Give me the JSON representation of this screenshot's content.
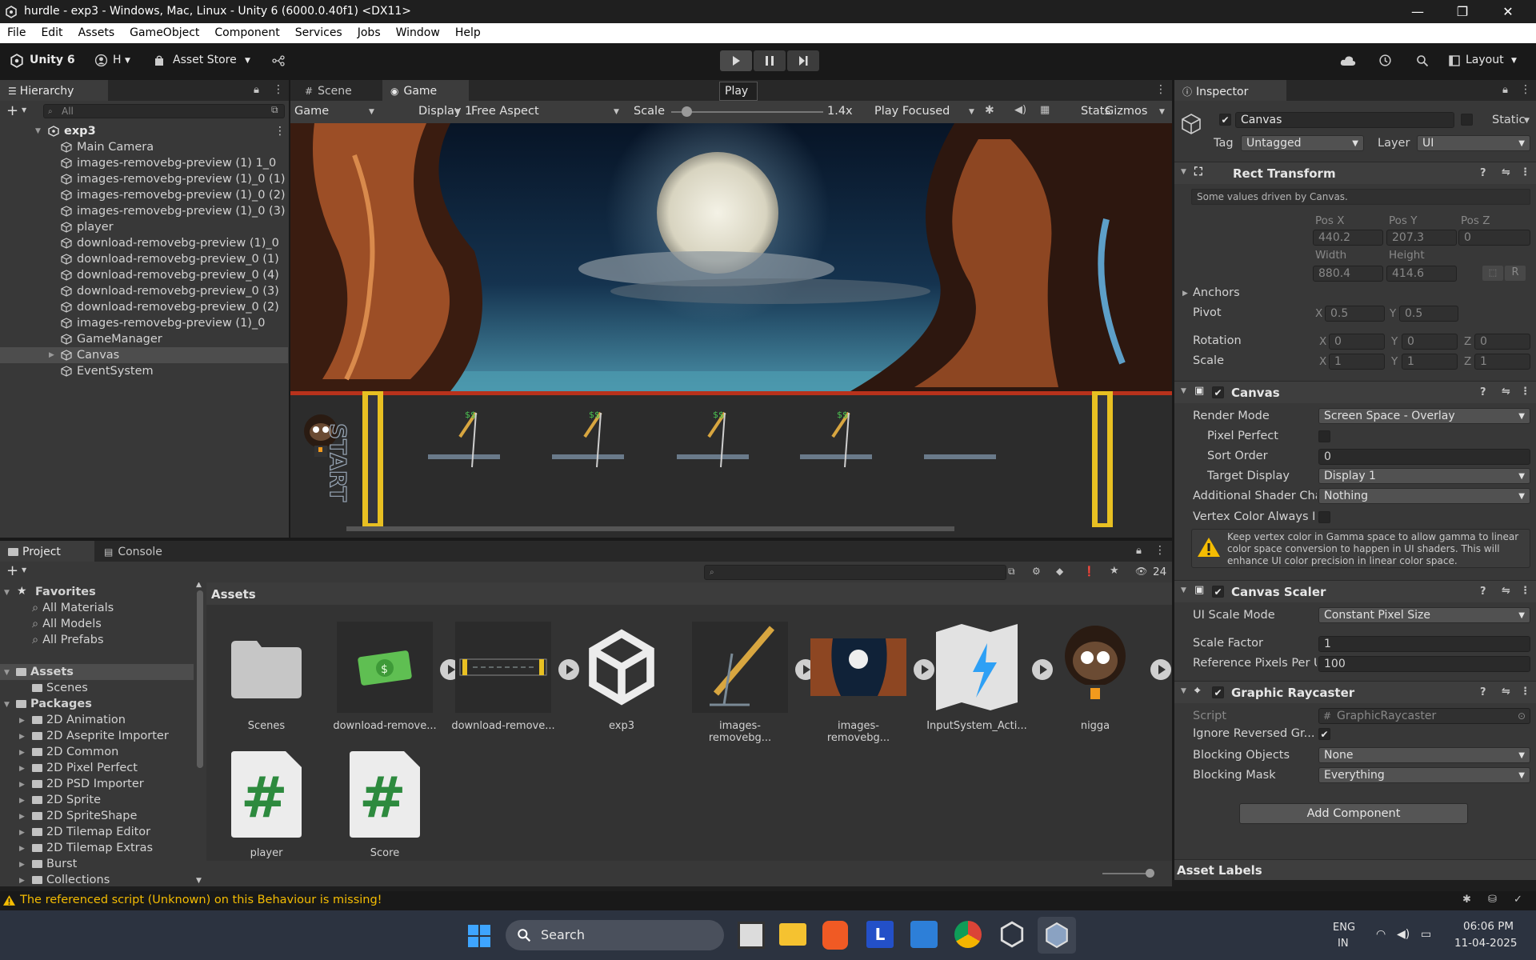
{
  "window": {
    "title": "hurdle - exp3 - Windows, Mac, Linux - Unity 6 (6000.0.40f1) <DX11>",
    "minimize": "—",
    "maximize": "❐",
    "close": "✕"
  },
  "menu": [
    "File",
    "Edit",
    "Assets",
    "GameObject",
    "Component",
    "Services",
    "Jobs",
    "Window",
    "Help"
  ],
  "toolbar": {
    "unity_label": "Unity 6",
    "account_label": "H",
    "asset_store_label": "Asset Store",
    "layout_label": "Layout",
    "play_tooltip": "Play"
  },
  "hierarchy": {
    "tab": "Hierarchy",
    "search_placeholder": "All",
    "scene": "exp3",
    "items": [
      "Main Camera",
      "images-removebg-preview (1) 1_0",
      "images-removebg-preview (1)_0 (1)",
      "images-removebg-preview (1)_0 (2)",
      "images-removebg-preview (1)_0 (3)",
      "player",
      "download-removebg-preview (1)_0",
      "download-removebg-preview_0 (1)",
      "download-removebg-preview_0 (4)",
      "download-removebg-preview_0 (3)",
      "download-removebg-preview_0 (2)",
      "images-removebg-preview (1)_0",
      "GameManager",
      "Canvas",
      "EventSystem"
    ],
    "selected_index": 13
  },
  "game_view": {
    "tabs": [
      "Scene",
      "Game"
    ],
    "active_tab": "Game",
    "mode": "Game",
    "display": "Display 1",
    "aspect": "Free Aspect",
    "scale_label": "Scale",
    "scale_value": "1.4x",
    "scale_fraction": 0.1,
    "play_mode": "Play Focused",
    "stats": "Stats",
    "gizmos": "Gizmos",
    "start_text": "START"
  },
  "inspector": {
    "tab": "Inspector",
    "object_name": "Canvas",
    "static_label": "Static",
    "tag_label": "Tag",
    "tag_value": "Untagged",
    "layer_label": "Layer",
    "layer_value": "UI",
    "rect_transform": {
      "title": "Rect Transform",
      "note": "Some values driven by Canvas.",
      "pos_x_label": "Pos X",
      "pos_x": "440.2",
      "pos_y_label": "Pos Y",
      "pos_y": "207.3",
      "pos_z_label": "Pos Z",
      "pos_z": "0",
      "width_label": "Width",
      "width": "880.4",
      "height_label": "Height",
      "height": "414.6",
      "r_button": "R",
      "anchors": "Anchors",
      "pivot": "Pivot",
      "pivot_x": "0.5",
      "pivot_y": "0.5",
      "rotation": "Rotation",
      "rot_x": "0",
      "rot_y": "0",
      "rot_z": "0",
      "scale": "Scale",
      "scale_x": "1",
      "scale_y": "1",
      "scale_z": "1",
      "x": "X",
      "y": "Y",
      "z": "Z"
    },
    "canvas": {
      "title": "Canvas",
      "render_mode_label": "Render Mode",
      "render_mode": "Screen Space - Overlay",
      "pixel_perfect_label": "Pixel Perfect",
      "sort_order_label": "Sort Order",
      "sort_order": "0",
      "target_display_label": "Target Display",
      "target_display": "Display 1",
      "shader_label": "Additional Shader Cha",
      "shader_value": "Nothing",
      "vertex_label": "Vertex Color Always I",
      "warning": "Keep vertex color in Gamma space to allow gamma to linear color space conversion to happen in UI shaders. This will enhance UI color precision in linear color space."
    },
    "canvas_scaler": {
      "title": "Canvas Scaler",
      "mode_label": "UI Scale Mode",
      "mode": "Constant Pixel Size",
      "factor_label": "Scale Factor",
      "factor": "1",
      "ref_label": "Reference Pixels Per U",
      "ref": "100"
    },
    "raycaster": {
      "title": "Graphic Raycaster",
      "script_label": "Script",
      "script": "GraphicRaycaster",
      "ignore_label": "Ignore Reversed Gr...",
      "blocking_objects_label": "Blocking Objects",
      "blocking_objects": "None",
      "blocking_mask_label": "Blocking Mask",
      "blocking_mask": "Everything"
    },
    "add_component": "Add Component",
    "asset_labels": "Asset Labels"
  },
  "project": {
    "tabs": [
      "Project",
      "Console"
    ],
    "favorites": "Favorites",
    "fav_items": [
      "All Materials",
      "All Models",
      "All Prefabs"
    ],
    "assets_root": "Assets",
    "scenes_folder": "Scenes",
    "packages": "Packages",
    "package_items": [
      "2D Animation",
      "2D Aseprite Importer",
      "2D Common",
      "2D Pixel Perfect",
      "2D PSD Importer",
      "2D Sprite",
      "2D SpriteShape",
      "2D Tilemap Editor",
      "2D Tilemap Extras",
      "Burst",
      "Collections"
    ],
    "breadcrumb": "Assets",
    "hidden_count": "24",
    "assets": [
      {
        "name": "Scenes",
        "kind": "folder"
      },
      {
        "name": "download-remove...",
        "kind": "money"
      },
      {
        "name": "download-remove...",
        "kind": "bar"
      },
      {
        "name": "exp3",
        "kind": "unity"
      },
      {
        "name": "images-removebg...",
        "kind": "hurdle"
      },
      {
        "name": "images-removebg...",
        "kind": "moon"
      },
      {
        "name": "InputSystem_Acti...",
        "kind": "input"
      },
      {
        "name": "nigga",
        "kind": "char"
      },
      {
        "name": "player",
        "kind": "script"
      },
      {
        "name": "Score",
        "kind": "script"
      }
    ]
  },
  "status": {
    "message": "The referenced script (Unknown) on this Behaviour is missing!"
  },
  "taskbar": {
    "search": "Search",
    "lang1": "ENG",
    "lang2": "IN",
    "time": "06:06 PM",
    "date": "11-04-2025"
  },
  "colors": {
    "accent": "#3a79bb",
    "selected_row": "#4d4d4d",
    "warning_yellow": "#f4bc02"
  }
}
